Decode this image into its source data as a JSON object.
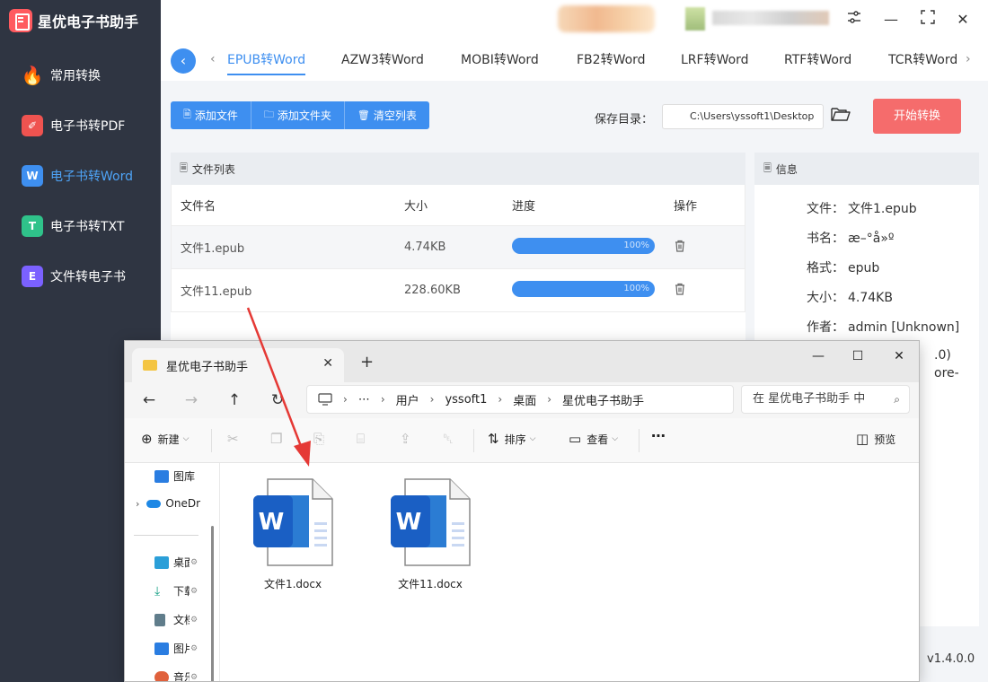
{
  "app": {
    "title": "星优电子书助手"
  },
  "sidebar": {
    "items": [
      {
        "label": "常用转换",
        "icon": "flame-icon",
        "color": "#ff5252"
      },
      {
        "label": "电子书转PDF",
        "icon": "pdf-icon",
        "color": "#ef5350"
      },
      {
        "label": "电子书转Word",
        "icon": "word-icon",
        "color": "#3e8ff0",
        "active": true,
        "glyph": "W"
      },
      {
        "label": "电子书转TXT",
        "icon": "txt-icon",
        "color": "#2fc28a",
        "glyph": "T"
      },
      {
        "label": "文件转电子书",
        "icon": "ebook-icon",
        "color": "#7b61ff",
        "glyph": "E"
      }
    ]
  },
  "tabs": [
    "EPUB转Word",
    "AZW3转Word",
    "MOBI转Word",
    "FB2转Word",
    "LRF转Word",
    "RTF转Word",
    "TCR转Word"
  ],
  "toolbar": {
    "add_file": "添加文件",
    "add_folder": "添加文件夹",
    "clear_list": "清空列表",
    "save_label": "保存目录：",
    "save_path": "C:\\Users\\yssoft1\\Desktop",
    "start": "开始转换"
  },
  "file_list": {
    "title": "文件列表",
    "headers": {
      "name": "文件名",
      "size": "大小",
      "progress": "进度",
      "action": "操作"
    },
    "rows": [
      {
        "name": "文件1.epub",
        "size": "4.74KB",
        "progress": "100%"
      },
      {
        "name": "文件11.epub",
        "size": "228.60KB",
        "progress": "100%"
      }
    ]
  },
  "info": {
    "title": "信息",
    "rows": [
      {
        "key": "文件：",
        "value": "文件1.epub"
      },
      {
        "key": "书名：",
        "value": "æ–°å»º"
      },
      {
        "key": "格式：",
        "value": "epub"
      },
      {
        "key": "大小：",
        "value": "4.74KB"
      },
      {
        "key": "作者：",
        "value": "admin [Unknown]"
      }
    ],
    "partial_1": ".0)",
    "partial_2": "ore-"
  },
  "version": "v1.4.0.0",
  "explorer": {
    "tab_title": "星优电子书助手",
    "address": [
      "用户",
      "yssoft1",
      "桌面",
      "星优电子书助手"
    ],
    "search_placeholder": "在 星优电子书助手 中",
    "commands": {
      "new": "新建",
      "sort": "排序",
      "view": "查看",
      "preview": "预览"
    },
    "sidebar": [
      {
        "label": "图库",
        "icon": "gallery-icon",
        "color": "#2a7de1"
      },
      {
        "label": "OneDr",
        "icon": "onedrive-icon",
        "color": "#1e88e5"
      },
      {
        "label": "桌面",
        "icon": "desktop-icon",
        "color": "#2b9fd8"
      },
      {
        "label": "下载",
        "icon": "download-icon",
        "color": "#16a085"
      },
      {
        "label": "文档",
        "icon": "documents-icon",
        "color": "#607d8b"
      },
      {
        "label": "图片",
        "icon": "pictures-icon",
        "color": "#2a7de1"
      },
      {
        "label": "音乐",
        "icon": "music-icon",
        "color": "#e0613c"
      }
    ],
    "files": [
      {
        "name": "文件1.docx",
        "icon": "word-doc-icon"
      },
      {
        "name": "文件11.docx",
        "icon": "word-doc-icon"
      }
    ]
  },
  "colors": {
    "accent": "#3e8ff0",
    "start_button": "#f56c6c",
    "sidebar_bg": "#2f3542",
    "annotation_arrow": "#e53935"
  }
}
